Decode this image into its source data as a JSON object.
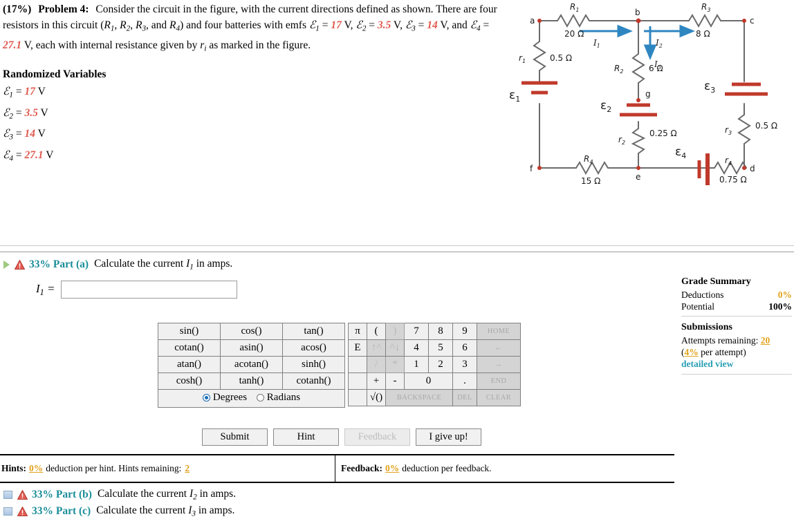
{
  "problem": {
    "percent": "(17%)",
    "label": "Problem 4:",
    "line1": "Consider the circuit in the figure, with the current directions defined as shown.",
    "line2a": "There are four resistors in this circuit (",
    "line2b": ") and four batteries with emfs",
    "resistor_list": "R₁, R₂, R₃, and R₄",
    "emf1_value": "17",
    "emf2_value": "3.5",
    "emf3_value": "14",
    "emf4_value": "27.1",
    "unit": "V",
    "tail": ", each with internal resistance given by",
    "tail2": "as marked in the figure."
  },
  "randomized_variables": {
    "title": "Randomized Variables",
    "rows": [
      {
        "symbol": "ℰ",
        "sub": "1",
        "eq": "=",
        "value": "17",
        "unit": "V"
      },
      {
        "symbol": "ℰ",
        "sub": "2",
        "eq": "=",
        "value": "3.5",
        "unit": "V"
      },
      {
        "symbol": "ℰ",
        "sub": "3",
        "eq": "=",
        "value": "14",
        "unit": "V"
      },
      {
        "symbol": "ℰ",
        "sub": "4",
        "eq": "=",
        "value": "27.1",
        "unit": "V"
      }
    ]
  },
  "circuit": {
    "nodes": [
      "a",
      "b",
      "c",
      "d",
      "e",
      "f",
      "g"
    ],
    "resistors": [
      {
        "name": "R1",
        "label": "R",
        "sub": "1",
        "value": "20 Ω"
      },
      {
        "name": "R2",
        "label": "R",
        "sub": "2",
        "value": "6 Ω"
      },
      {
        "name": "R3",
        "label": "R",
        "sub": "3",
        "value": "8 Ω"
      },
      {
        "name": "R4",
        "label": "R",
        "sub": "4",
        "value": "15 Ω"
      }
    ],
    "internal_resistances": [
      {
        "name": "r1",
        "label": "r",
        "sub": "1",
        "value": "0.5 Ω"
      },
      {
        "name": "r2",
        "label": "r",
        "sub": "2",
        "value": "0.25 Ω"
      },
      {
        "name": "r3",
        "label": "r",
        "sub": "3",
        "value": "0.5 Ω"
      },
      {
        "name": "r4",
        "label": "r",
        "sub": "4",
        "value": "0.75 Ω"
      }
    ],
    "batteries": [
      {
        "name": "E1",
        "label": "ε",
        "sub": "1"
      },
      {
        "name": "E2",
        "label": "ε",
        "sub": "2"
      },
      {
        "name": "E3",
        "label": "ε",
        "sub": "3"
      },
      {
        "name": "E4",
        "label": "ε",
        "sub": "4"
      }
    ],
    "currents": [
      {
        "name": "I1",
        "label": "I",
        "sub": "1"
      },
      {
        "name": "I2",
        "label": "I",
        "sub": "2"
      },
      {
        "name": "I3",
        "label": "I",
        "sub": "3"
      }
    ],
    "colors": {
      "wire": "#6a6a6a",
      "battery": "#c0392b",
      "node": "#c0392b",
      "current_arrow": "#2e86c1",
      "text": "#1a1a1a"
    }
  },
  "part_a": {
    "percent": "33% Part (a)",
    "text": "Calculate the current I₁ in amps.",
    "answer_label": "I",
    "answer_sub": "1",
    "answer_eq": "=",
    "answer_value": "",
    "answer_placeholder": ""
  },
  "calculator": {
    "functions": [
      [
        "sin()",
        "cos()",
        "tan()"
      ],
      [
        "cotan()",
        "asin()",
        "acos()"
      ],
      [
        "atan()",
        "acotan()",
        "sinh()"
      ],
      [
        "cosh()",
        "tanh()",
        "cotanh()"
      ]
    ],
    "angle_modes": [
      {
        "label": "Degrees",
        "selected": true
      },
      {
        "label": "Radians",
        "selected": false
      }
    ],
    "keypad": [
      [
        {
          "label": "π",
          "state": "on",
          "w": "narrow"
        },
        {
          "label": "(",
          "state": "on",
          "w": "narrow"
        },
        {
          "label": ")",
          "state": "dim",
          "w": "narrow"
        },
        {
          "label": "7",
          "state": "on"
        },
        {
          "label": "8",
          "state": "on"
        },
        {
          "label": "9",
          "state": "on"
        },
        {
          "label": "HOME",
          "state": "home"
        }
      ],
      [
        {
          "label": "E",
          "state": "on",
          "w": "narrow"
        },
        {
          "label": "↑^",
          "state": "dim",
          "w": "narrow"
        },
        {
          "label": "^↓",
          "state": "dim",
          "w": "narrow"
        },
        {
          "label": "4",
          "state": "on"
        },
        {
          "label": "5",
          "state": "on"
        },
        {
          "label": "6",
          "state": "on"
        },
        {
          "label": "←",
          "state": "home"
        }
      ],
      [
        {
          "label": "",
          "state": "blank",
          "w": "narrow"
        },
        {
          "label": "/",
          "state": "dim",
          "w": "narrow"
        },
        {
          "label": "*",
          "state": "dim",
          "w": "narrow"
        },
        {
          "label": "1",
          "state": "on"
        },
        {
          "label": "2",
          "state": "on"
        },
        {
          "label": "3",
          "state": "on"
        },
        {
          "label": "→",
          "state": "home"
        }
      ],
      [
        {
          "label": "",
          "state": "blank",
          "w": "narrow"
        },
        {
          "label": "+",
          "state": "on",
          "w": "narrow"
        },
        {
          "label": "-",
          "state": "on",
          "w": "narrow"
        },
        {
          "label": "0",
          "state": "on",
          "span": 2
        },
        {
          "label": ".",
          "state": "on"
        },
        {
          "label": "END",
          "state": "home"
        }
      ],
      [
        {
          "label": "",
          "state": "blank",
          "w": "narrow"
        },
        {
          "label": "√()",
          "state": "on",
          "w": "narrow"
        },
        {
          "label": "BACKSPACE",
          "state": "wide",
          "span": 3
        },
        {
          "label": "DEL",
          "state": "wide"
        },
        {
          "label": "CLEAR",
          "state": "home"
        }
      ]
    ]
  },
  "actions": [
    {
      "label": "Submit",
      "enabled": true
    },
    {
      "label": "Hint",
      "enabled": true
    },
    {
      "label": "Feedback",
      "enabled": false
    },
    {
      "label": "I give up!",
      "enabled": true
    }
  ],
  "hints": {
    "label": "Hints:",
    "pct": "0%",
    "mid": "deduction per hint. Hints remaining:",
    "remaining": "2"
  },
  "feedback": {
    "label": "Feedback:",
    "pct": "0%",
    "text": "deduction per feedback."
  },
  "other_parts": [
    {
      "percent": "33% Part (b)",
      "text": "Calculate the current I₂ in amps."
    },
    {
      "percent": "33% Part (c)",
      "text": "Calculate the current I₃ in amps."
    }
  ],
  "grade_summary": {
    "title": "Grade Summary",
    "deductions_label": "Deductions",
    "deductions_value": "0%",
    "potential_label": "Potential",
    "potential_value": "100%",
    "submissions_title": "Submissions",
    "attempts_label": "Attempts remaining:",
    "attempts_value": "20",
    "per_attempt_open": "(",
    "per_attempt_pct": "4%",
    "per_attempt_rest": "per attempt)",
    "detailed_view": "detailed view"
  }
}
